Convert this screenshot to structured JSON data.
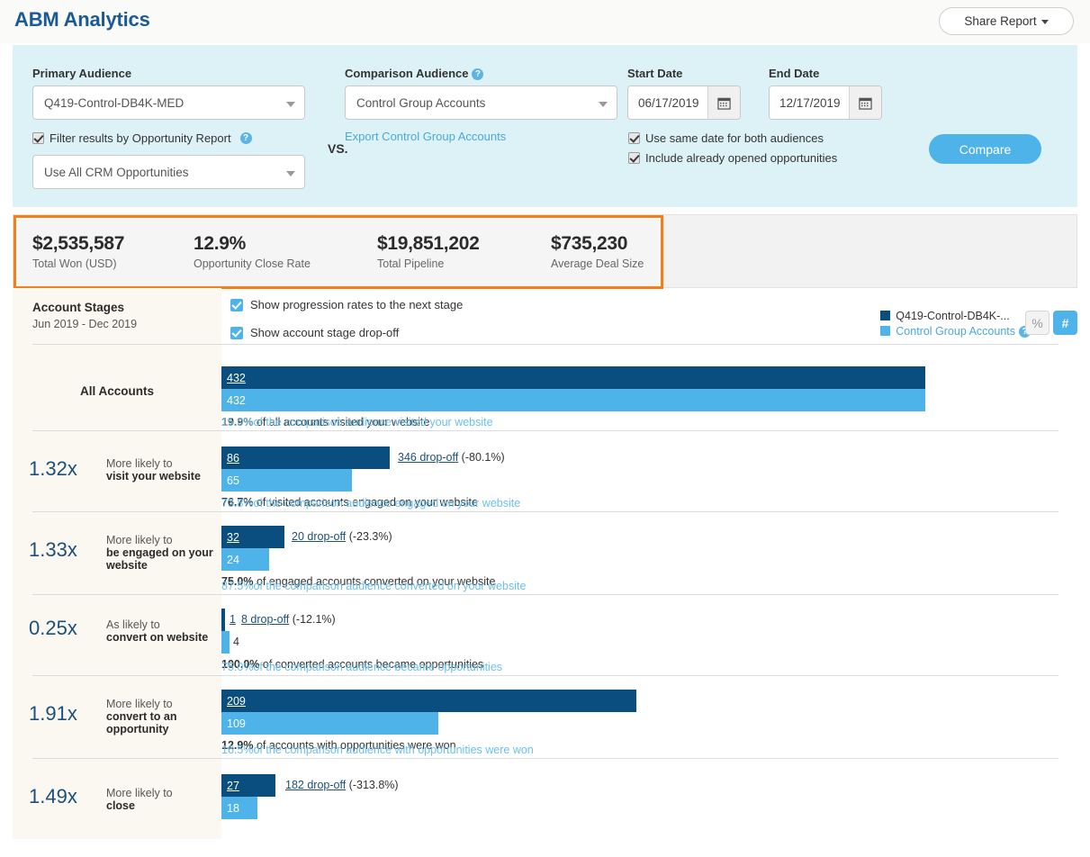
{
  "app": {
    "title": "ABM Analytics",
    "share_label": "Share Report"
  },
  "filters": {
    "primary_audience_label": "Primary Audience",
    "primary_audience_value": "Q419-Control-DB4K-MED",
    "vs_label": "VS.",
    "comparison_audience_label": "Comparison Audience",
    "comparison_audience_value": "Control Group Accounts",
    "export_link": "Export Control Group Accounts",
    "filter_by_opportunity_label": "Filter results by Opportunity Report",
    "opportunity_report_value": "Use All CRM Opportunities",
    "start_date_label": "Start Date",
    "start_date_value": "06/17/2019",
    "end_date_label": "End Date",
    "end_date_value": "12/17/2019",
    "same_date_label": "Use same date for both audiences",
    "include_opened_label": "Include already opened opportunities",
    "compare_label": "Compare"
  },
  "kpis": [
    {
      "value": "$2,535,587",
      "label": "Total Won (USD)"
    },
    {
      "value": "12.9%",
      "label": "Opportunity Close Rate"
    },
    {
      "value": "$19,851,202",
      "label": "Total Pipeline"
    },
    {
      "value": "$735,230",
      "label": "Average Deal Size"
    }
  ],
  "chart_header": {
    "title": "Account Stages",
    "subtitle": "Jun 2019 - Dec 2019",
    "option_progression": "Show progression rates to the next stage",
    "option_dropoff": "Show account stage drop-off",
    "legend_primary": "Q419-Control-DB4K-...",
    "legend_control": "Control Group Accounts",
    "toggle_percent": "%",
    "toggle_number": "#"
  },
  "colors": {
    "primary_series": "#0a4e7f",
    "control_series": "#4eb3e8",
    "accent": "#4eb3e8",
    "highlight_border": "#f08018",
    "brand_title": "#1a5a96"
  },
  "chart_data": {
    "type": "bar",
    "title": "Account Stages",
    "subtitle": "Jun 2019 - Dec 2019",
    "orientation": "horizontal",
    "series": [
      {
        "name": "Q419-Control-DB4K-...",
        "color": "#0a4e7f",
        "values": [
          432,
          86,
          32,
          1,
          209,
          27
        ]
      },
      {
        "name": "Control Group Accounts",
        "color": "#4eb3e8",
        "values": [
          432,
          65,
          24,
          4,
          109,
          18
        ]
      }
    ],
    "categories": [
      "All Accounts",
      "visit your website",
      "be engaged on your website",
      "convert on website",
      "convert to an opportunity",
      "close"
    ],
    "xlim": [
      0,
      432
    ],
    "grid": false,
    "legend_position": "top-right",
    "stages": [
      {
        "multiplier": "",
        "likely_prefix": "",
        "stage_name": "All Accounts",
        "primary_value": "432",
        "control_value": "432",
        "dropoff_count": "",
        "dropoff_pct": "",
        "progression_primary_pct": "19.9%",
        "progression_primary_text": "of all accounts visited your website",
        "progression_control_pct": "15.0%",
        "progression_control_text": "of the comparison audience visited your website"
      },
      {
        "multiplier": "1.32x",
        "likely_prefix": "More likely to",
        "stage_name": "visit your website",
        "primary_value": "86",
        "control_value": "65",
        "dropoff_count": "346 drop-off",
        "dropoff_pct": "(-80.1%)",
        "progression_primary_pct": "76.7%",
        "progression_primary_text": "of visited accounts engaged on your website",
        "progression_control_pct": "73.8%",
        "progression_control_text": "of the comparison audience engaged on your website"
      },
      {
        "multiplier": "1.33x",
        "likely_prefix": "More likely to",
        "stage_name": "be engaged on your website",
        "primary_value": "32",
        "control_value": "24",
        "dropoff_count": "20 drop-off",
        "dropoff_pct": "(-23.3%)",
        "progression_primary_pct": "75.0%",
        "progression_primary_text": "of engaged accounts converted on your website",
        "progression_control_pct": "87.5%",
        "progression_control_text": "of the comparison audience converted on your website"
      },
      {
        "multiplier": "0.25x",
        "likely_prefix": "As likely to",
        "stage_name": "convert on website",
        "primary_value": "1",
        "control_value": "4",
        "dropoff_count": "8 drop-off",
        "dropoff_pct": "(-12.1%)",
        "progression_primary_pct": "100.0%",
        "progression_primary_text": "of converted accounts became opportunities",
        "progression_control_pct": "75.0%",
        "progression_control_text": "of the comparison audience became opportunities"
      },
      {
        "multiplier": "1.91x",
        "likely_prefix": "More likely to",
        "stage_name": "convert to an opportunity",
        "primary_value": "209",
        "control_value": "109",
        "dropoff_count": "",
        "dropoff_pct": "",
        "progression_primary_pct": "12.9%",
        "progression_primary_text": "of accounts with opportunities were won",
        "progression_control_pct": "16.5%",
        "progression_control_text": "of the comparison audience with opportunities were won"
      },
      {
        "multiplier": "1.49x",
        "likely_prefix": "More likely to",
        "stage_name": "close",
        "primary_value": "27",
        "control_value": "18",
        "dropoff_count": "182 drop-off",
        "dropoff_pct": "(-313.8%)",
        "progression_primary_pct": "",
        "progression_primary_text": "",
        "progression_control_pct": "",
        "progression_control_text": ""
      }
    ]
  }
}
